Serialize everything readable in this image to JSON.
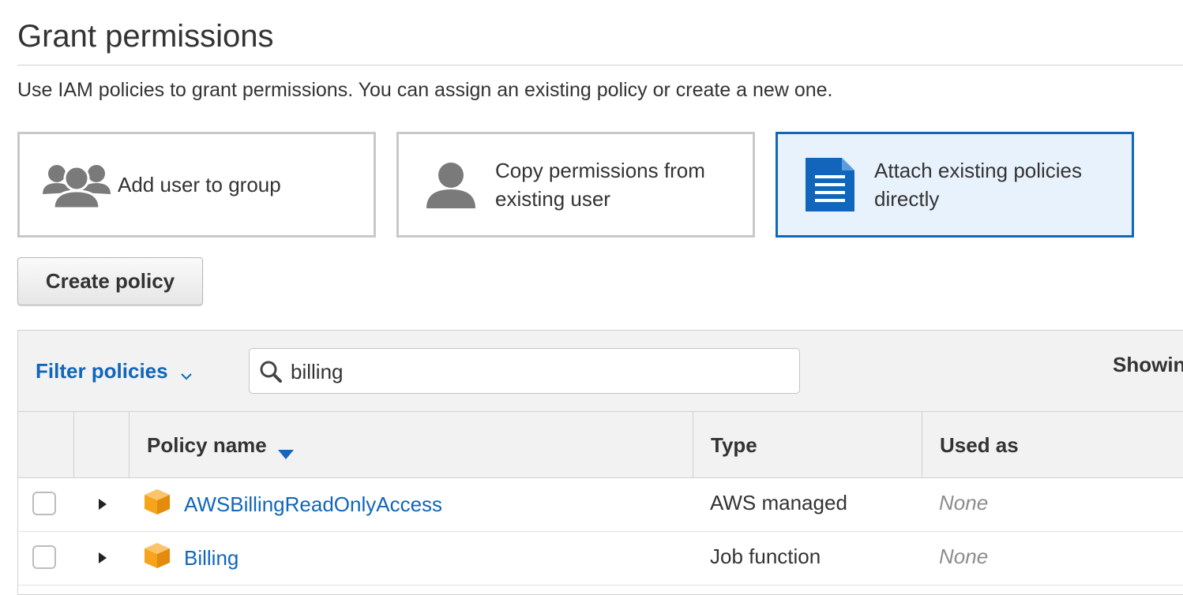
{
  "page": {
    "title": "Grant permissions",
    "description": "Use IAM policies to grant permissions. You can assign an existing policy or create a new one."
  },
  "options": [
    {
      "label": "Add user to group",
      "icon": "users-group-icon",
      "selected": false
    },
    {
      "label": "Copy permissions from existing user",
      "icon": "user-icon",
      "selected": false
    },
    {
      "label": "Attach existing policies directly",
      "icon": "document-icon",
      "selected": true
    }
  ],
  "toolbar": {
    "create_policy_label": "Create policy",
    "filter_label": "Filter policies",
    "search_value": "billing",
    "showing_text": "Showing"
  },
  "table": {
    "headers": {
      "policy_name": "Policy name",
      "type": "Type",
      "used_as": "Used as"
    },
    "rows": [
      {
        "name": "AWSBillingReadOnlyAccess",
        "type": "AWS managed",
        "used_as": "None"
      },
      {
        "name": "Billing",
        "type": "Job function",
        "used_as": "None"
      }
    ]
  },
  "colors": {
    "accent": "#1166bb",
    "selected_bg": "#e8f2fd",
    "policy_icon": "#f7a41d",
    "icon_gray": "#7a7a7a"
  }
}
